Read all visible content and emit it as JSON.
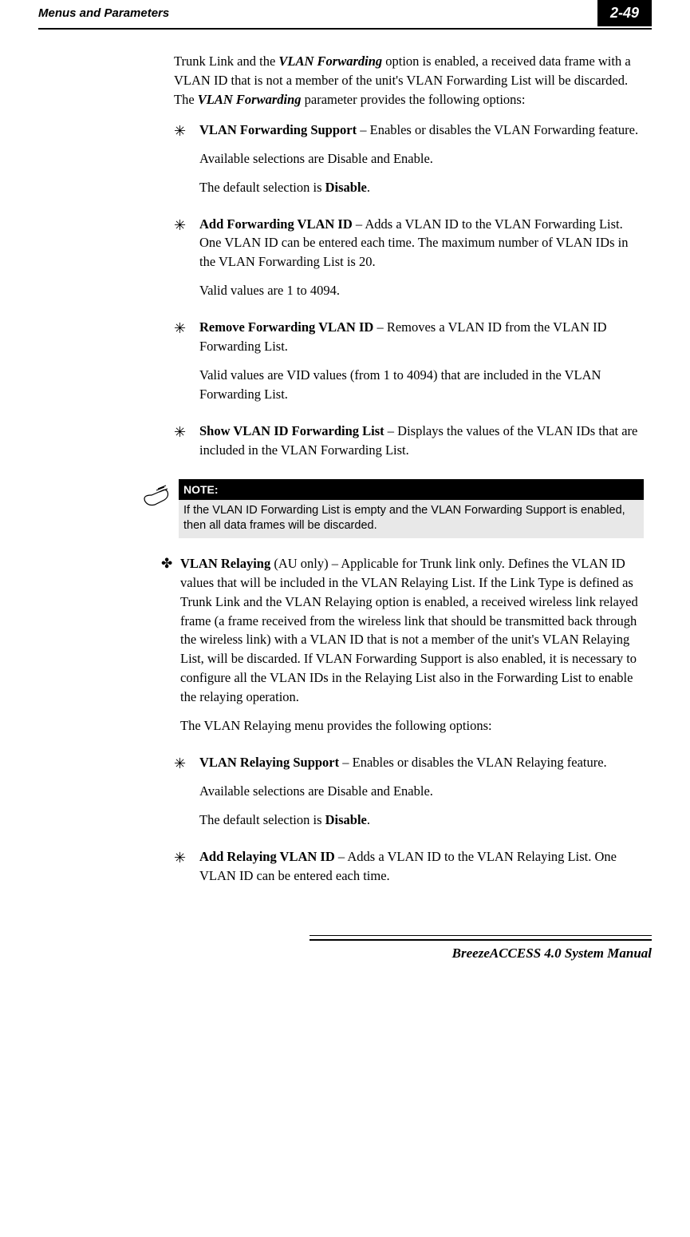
{
  "header": {
    "title": "Menus and Parameters",
    "page": "2-49"
  },
  "intro": {
    "text_before_bold1": "Trunk Link and the ",
    "bold1": "VLAN Forwarding",
    "text_mid1": " option is enabled, a received data frame with a VLAN ID that is not a member of the unit's VLAN Forwarding List will be discarded. The ",
    "bold2": "VLAN Forwarding",
    "text_after": " parameter provides the following options:"
  },
  "items": {
    "item1": {
      "title": "VLAN Forwarding Support",
      "desc": " – Enables or disables the VLAN Forwarding feature.",
      "sub1": "Available selections are Disable and Enable.",
      "sub2_pre": "The default selection is ",
      "sub2_bold": "Disable",
      "sub2_post": "."
    },
    "item2": {
      "title": "Add Forwarding VLAN ID",
      "desc": " – Adds a VLAN ID to the VLAN Forwarding List. One VLAN ID can be entered each time. The maximum number of VLAN IDs in the VLAN Forwarding List is 20.",
      "sub1": "Valid values are 1 to 4094."
    },
    "item3": {
      "title": "Remove Forwarding VLAN ID",
      "desc": " – Removes a VLAN ID from the VLAN ID Forwarding List.",
      "sub1": "Valid values are VID values (from 1 to 4094) that are included in the VLAN Forwarding List."
    },
    "item4": {
      "title": "Show VLAN ID Forwarding List",
      "desc": " – Displays the values of the VLAN IDs that are included in the VLAN Forwarding List."
    }
  },
  "note": {
    "header": "NOTE:",
    "body": "If the VLAN ID Forwarding List is empty and the VLAN Forwarding Support is enabled, then all data frames will be discarded."
  },
  "relaying": {
    "title": "VLAN Relaying",
    "desc": " (AU only) – Applicable for Trunk link only. Defines the VLAN ID values that will be included in the VLAN Relaying List. If the Link Type is defined as Trunk Link and the VLAN Relaying option is enabled, a received wireless link relayed frame (a frame received from the wireless link that should be transmitted back through the wireless link) with a VLAN ID that is not a member of the unit's VLAN Relaying List, will be discarded. If VLAN Forwarding Support is also enabled, it is necessary to configure all the VLAN IDs in the Relaying List also in the Forwarding List to enable the relaying operation.",
    "sub1": "The VLAN Relaying menu provides the following options:"
  },
  "relay_items": {
    "r1": {
      "title": "VLAN Relaying Support",
      "desc": " – Enables or disables the VLAN Relaying feature.",
      "sub1": "Available selections are Disable and Enable.",
      "sub2_pre": "The default selection is ",
      "sub2_bold": "Disable",
      "sub2_post": "."
    },
    "r2": {
      "title": "Add Relaying VLAN ID",
      "desc": " – Adds a VLAN ID to the VLAN Relaying List. One VLAN ID can be entered each time."
    }
  },
  "footer": {
    "text": "BreezeACCESS 4.0 System Manual"
  }
}
